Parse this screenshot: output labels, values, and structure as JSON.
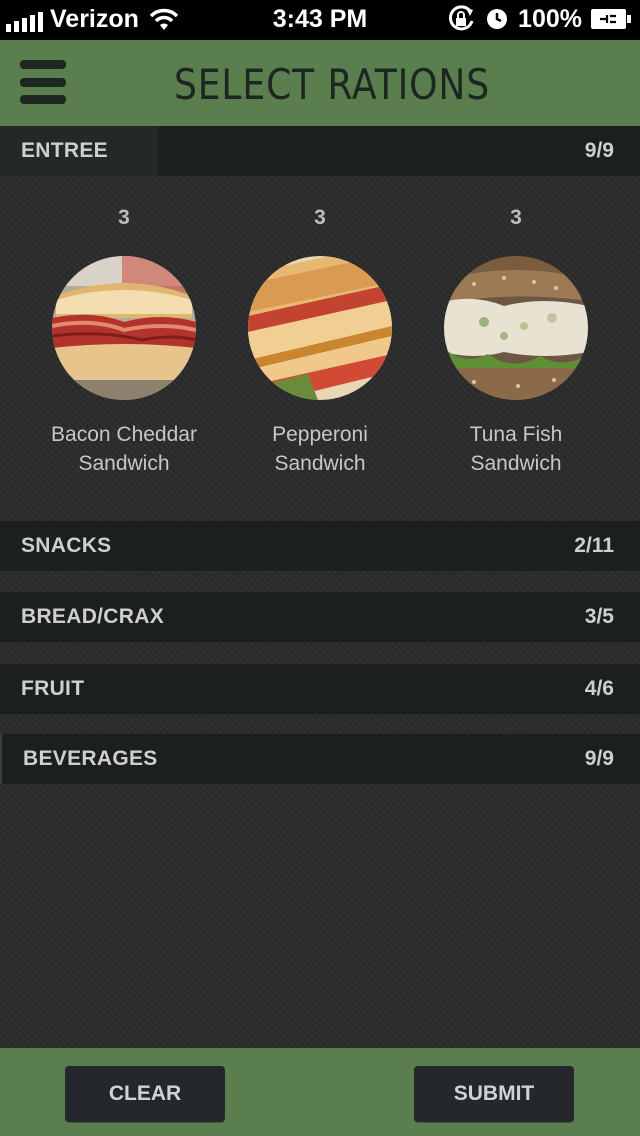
{
  "status_bar": {
    "carrier": "Verizon",
    "time": "3:43 PM",
    "battery": "100%",
    "icons": [
      "signal-icon",
      "wifi-icon",
      "rotation-lock-icon",
      "alarm-clock-icon",
      "battery-charging-icon"
    ]
  },
  "header": {
    "title": "SELECT RATIONS",
    "menu_icon": "hamburger-menu-icon",
    "background": "#5a7e4e"
  },
  "sections": [
    {
      "label": "ENTREE",
      "count": "9/9",
      "expanded": true,
      "items": [
        {
          "qty": "3",
          "name": "Bacon Cheddar\nSandwich",
          "image": "bacon-cheddar-sandwich-photo"
        },
        {
          "qty": "3",
          "name": "Pepperoni\nSandwich",
          "image": "pepperoni-sandwich-photo"
        },
        {
          "qty": "3",
          "name": "Tuna Fish\nSandwich",
          "image": "tuna-fish-sandwich-photo"
        }
      ]
    },
    {
      "label": "SNACKS",
      "count": "2/11",
      "expanded": false
    },
    {
      "label": "BREAD/CRAX",
      "count": "3/5",
      "expanded": false
    },
    {
      "label": "FRUIT",
      "count": "4/6",
      "expanded": false
    },
    {
      "label": "BEVERAGES",
      "count": "9/9",
      "expanded": false
    }
  ],
  "footer": {
    "clear_label": "CLEAR",
    "submit_label": "SUBMIT",
    "background": "#5a7e4e"
  },
  "colors": {
    "accent_green": "#5a7e4e",
    "section_bar": "#1b1f1f",
    "button_dark": "#24272b"
  }
}
